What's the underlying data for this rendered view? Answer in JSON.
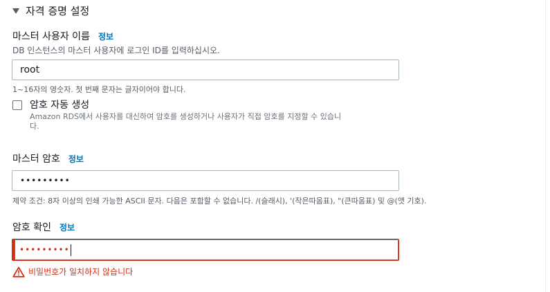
{
  "section": {
    "title": "자격 증명 설정",
    "icon": "caret-down-icon"
  },
  "master_username": {
    "label": "마스터 사용자 이름",
    "info": "정보",
    "description": "DB 인스턴스의 마스터 사용자에 로그인 ID를 입력하십시오.",
    "value": "root",
    "constraint": "1~16자의 영숫자. 첫 번째 문자는 글자이어야 합니다."
  },
  "auto_password": {
    "label": "암호 자동 생성",
    "checked": false,
    "description_line1": "Amazon RDS에서 사용자를 대신하여 암호를 생성하거나 사용자가 직접 암호를 지정할 수 있습니",
    "description_line2": "다."
  },
  "master_password": {
    "label": "마스터 암호",
    "info": "정보",
    "value": "•••••••••",
    "constraint": "제약 조건: 8자 이상의 인쇄 가능한 ASCII 문자. 다음은 포함할 수 없습니다. /(슬래시), '(작은따옴표), \"(큰따옴표) 및 @(앳 기호)."
  },
  "confirm_password": {
    "label": "암호 확인",
    "info": "정보",
    "value": "•••••••••",
    "error": "비밀번호가 일치하지 않습니다",
    "error_icon": "warning-icon"
  },
  "colors": {
    "link": "#0073bb",
    "error": "#d13212",
    "text": "#16191f",
    "muted": "#545b64",
    "border": "#aab7b8"
  }
}
